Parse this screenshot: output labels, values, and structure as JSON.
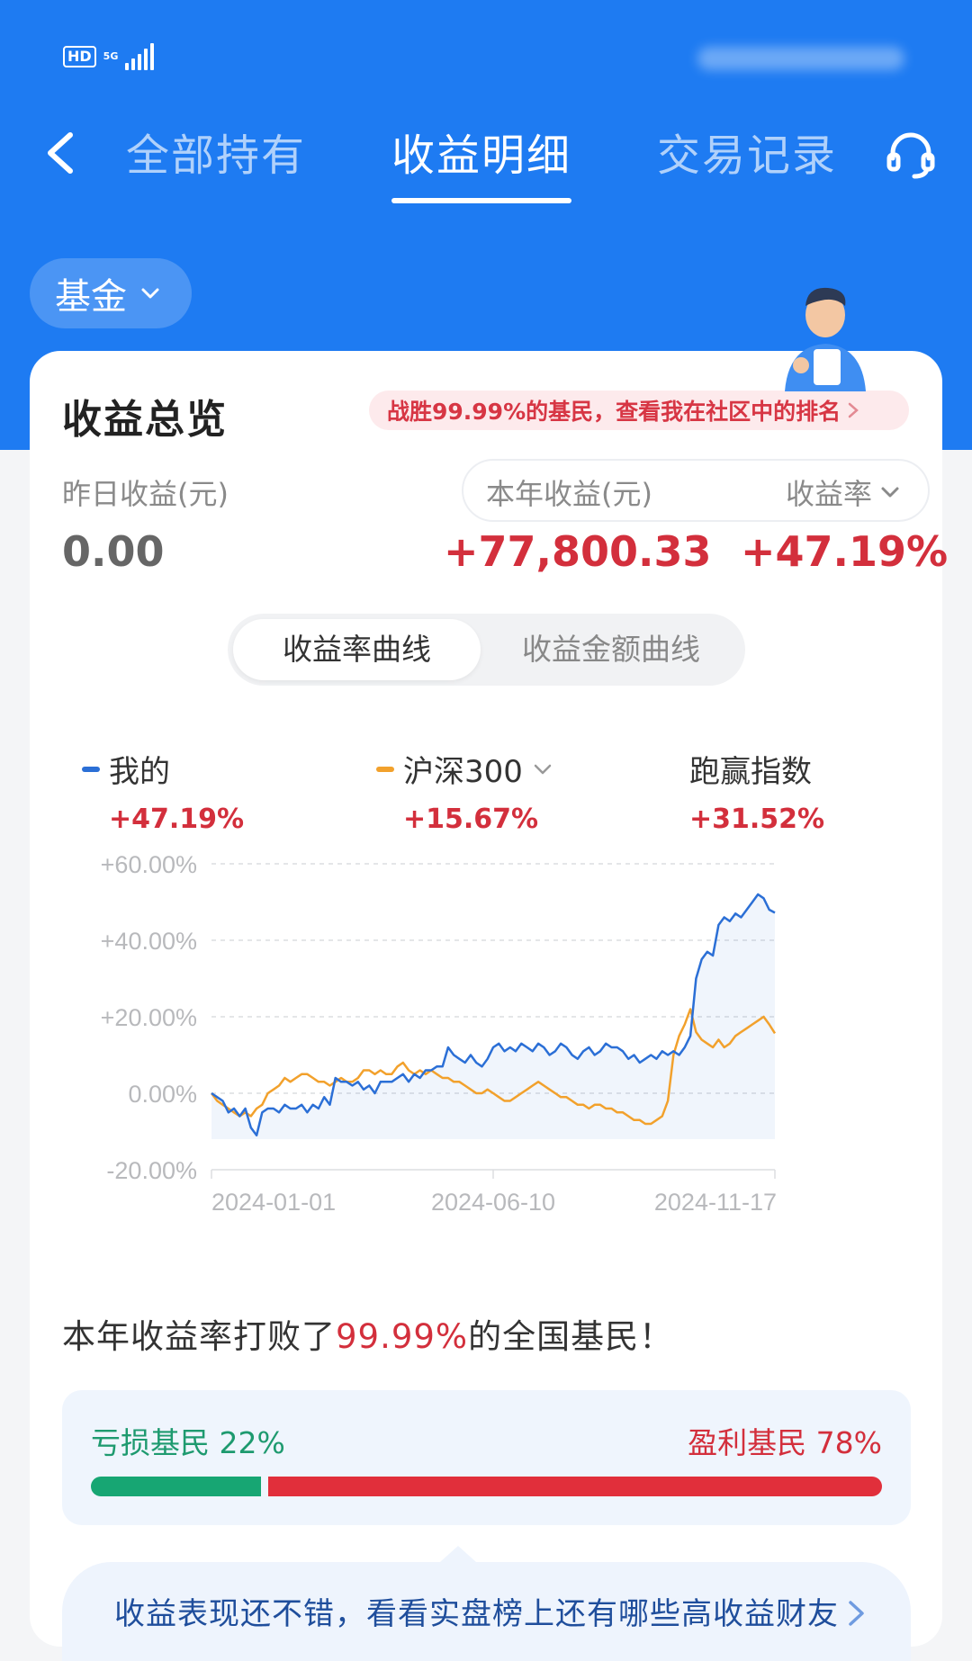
{
  "status": {
    "hd": "HD",
    "network": "5G"
  },
  "nav": {
    "tabs": [
      {
        "label": "全部持有"
      },
      {
        "label": "收益明细"
      },
      {
        "label": "交易记录"
      }
    ],
    "active_tab": 1
  },
  "filter": {
    "label": "基金"
  },
  "overview": {
    "title": "收益总览",
    "rank_banner": "战胜99.99%的基民，查看我在社区中的排名",
    "yesterday_label": "昨日收益(元)",
    "yesterday_value": "0.00",
    "year_label": "本年收益(元)",
    "year_value": "+77,800.33",
    "rate_label": "收益率",
    "rate_value": "+47.19%"
  },
  "curve_toggle": {
    "options": [
      "收益率曲线",
      "收益金额曲线"
    ],
    "active": 0
  },
  "legend": [
    {
      "name": "我的",
      "value": "+47.19%",
      "color": "#2b6fd6"
    },
    {
      "name": "沪深300",
      "value": "+15.67%",
      "color": "#f2a12c"
    },
    {
      "name": "跑赢指数",
      "value": "+31.52%"
    }
  ],
  "chart_data": {
    "type": "line",
    "y_ticks": [
      "+60.00%",
      "+40.00%",
      "+20.00%",
      "0.00%",
      "-20.00%"
    ],
    "x_ticks": [
      "2024-01-01",
      "2024-06-10",
      "2024-11-17"
    ],
    "ylim": [
      -20,
      60
    ],
    "grid": true,
    "x_index_of_ticks": [
      0,
      50,
      100
    ],
    "series": [
      {
        "name": "我的",
        "color": "#2b6fd6",
        "values": [
          0,
          -1,
          -2,
          -5,
          -4,
          -6,
          -4,
          -9,
          -11,
          -5,
          -4,
          -4,
          -5,
          -3,
          -4,
          -4,
          -3,
          -5,
          -3,
          -4,
          -1,
          -3,
          4,
          3,
          3,
          2,
          3,
          1,
          2,
          0,
          3,
          3,
          3,
          4,
          5,
          3,
          5,
          4,
          6,
          6,
          7,
          7,
          12,
          10,
          9,
          8,
          10,
          8,
          7,
          9,
          12,
          13,
          11,
          12,
          11,
          13,
          12,
          11,
          13,
          12,
          10,
          11,
          13,
          12,
          10,
          9,
          11,
          12,
          10,
          11,
          13,
          12,
          12,
          11,
          9,
          10,
          8,
          9,
          10,
          9,
          11,
          10,
          11,
          10,
          12,
          15,
          30,
          35,
          37,
          36,
          44,
          46,
          45,
          47,
          46,
          48,
          50,
          52,
          51,
          48,
          47.19
        ]
      },
      {
        "name": "沪深300",
        "color": "#f2a12c",
        "values": [
          0,
          -2,
          -3,
          -4,
          -5,
          -6,
          -5,
          -6,
          -4,
          -3,
          0,
          1,
          2,
          4,
          3,
          4,
          5,
          5,
          4,
          3,
          3,
          2,
          3,
          4,
          3,
          3,
          4,
          6,
          6,
          5,
          6,
          5,
          5,
          7,
          8,
          6,
          5,
          6,
          5,
          6,
          5,
          4,
          4,
          3,
          3,
          2,
          1,
          0,
          0,
          1,
          0,
          -1,
          -2,
          -2,
          -1,
          0,
          1,
          2,
          3,
          2,
          1,
          0,
          -1,
          -1,
          -2,
          -3,
          -3,
          -4,
          -3,
          -3,
          -4,
          -4,
          -5,
          -5,
          -6,
          -7,
          -7,
          -8,
          -8,
          -7,
          -6,
          -2,
          10,
          15,
          18,
          22,
          16,
          14,
          13,
          12,
          14,
          12,
          13,
          15,
          16,
          17,
          18,
          19,
          20,
          18,
          15.67
        ]
      }
    ]
  },
  "beat": {
    "prefix": "本年收益率打败了",
    "highlight": "99.99%",
    "suffix": "的全国基民！"
  },
  "distribution": {
    "loss_label": "亏损基民 22%",
    "gain_label": "盈利基民 78%",
    "loss_share": 0.22,
    "gain_share": 0.78
  },
  "promo": {
    "text": "收益表现还不错，看看实盘榜上还有哪些高收益财友"
  }
}
